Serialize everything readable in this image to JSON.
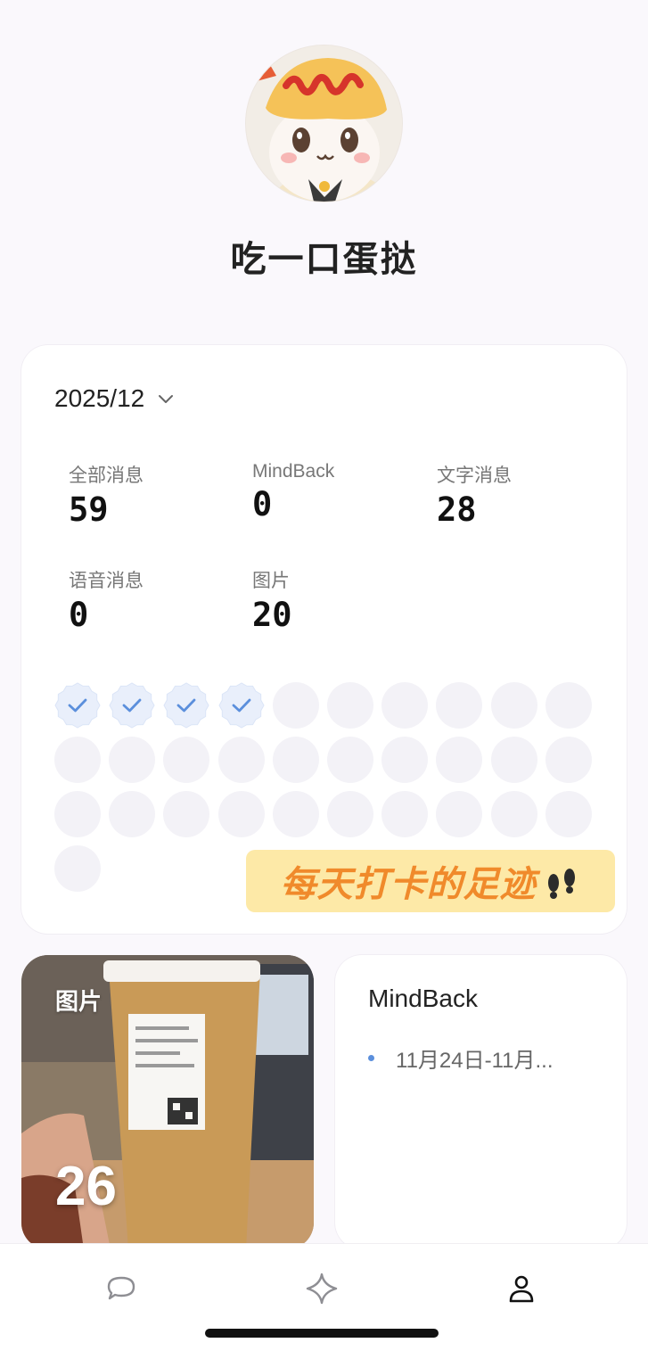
{
  "profile": {
    "name": "吃一口蛋挞"
  },
  "stats": {
    "month": "2025/12",
    "items": [
      {
        "label": "全部消息",
        "value": "59"
      },
      {
        "label": "MindBack",
        "value": "0"
      },
      {
        "label": "文字消息",
        "value": "28"
      },
      {
        "label": "语音消息",
        "value": "0"
      },
      {
        "label": "图片",
        "value": "20"
      }
    ],
    "checkin_days_total": 31,
    "checkin_days_done": 4,
    "banner_text": "每天打卡的足迹"
  },
  "photo_card": {
    "label": "图片",
    "count": "26"
  },
  "mindback_card": {
    "title": "MindBack",
    "items": [
      "11月24日-11月..."
    ]
  },
  "tabs": [
    {
      "name": "chat-icon"
    },
    {
      "name": "sparkle-icon"
    },
    {
      "name": "profile-icon"
    }
  ],
  "colors": {
    "accent": "#5b8fdc",
    "banner_bg": "#fde9a7",
    "banner_text": "#f08a2b"
  }
}
